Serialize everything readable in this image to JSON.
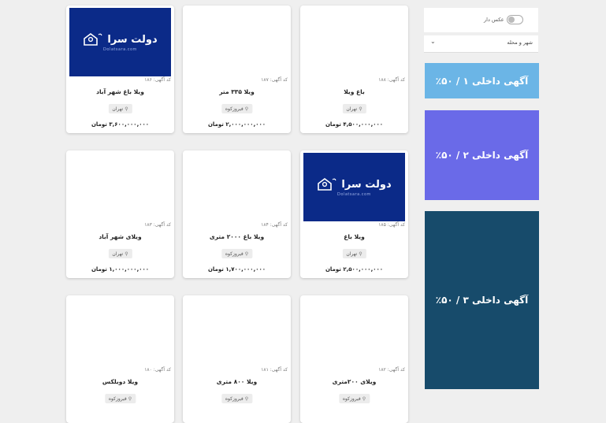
{
  "sidebar": {
    "toggle_label": "عکس دار",
    "select_value": "شهر و محله",
    "banners": [
      {
        "text": "آگهی داخلی ۱ / ۵۰٪",
        "color": "#6bb5e6"
      },
      {
        "text": "آگهی داخلی ۲ / ۵۰٪",
        "color": "#6a6ae8"
      },
      {
        "text": "آگهی داخلی ۳ / ۵۰٪",
        "color": "#174b6b"
      }
    ]
  },
  "brand": {
    "logo_text": "دولت سرا",
    "logo_sub": "Dolatsara.com",
    "color": "#0b2a88"
  },
  "cards": [
    {
      "code": "کد آگهی: ۱۸۸",
      "title": "باغ ویلا",
      "location": "تهران",
      "price": "۴,۵۰۰,۰۰۰,۰۰۰ تومان",
      "has_logo": false
    },
    {
      "code": "کد آگهی: ۱۸۷",
      "title": "ویلا ۳۳۵ متر",
      "location": "فیروزکوه",
      "price": "۲,۰۰۰,۰۰۰,۰۰۰ تومان",
      "has_logo": false
    },
    {
      "code": "کد آگهی: ۱۸۶",
      "title": "ویلا باغ شهر آباد",
      "location": "تهران",
      "price": "۳,۶۰۰,۰۰۰,۰۰۰ تومان",
      "has_logo": true
    },
    {
      "code": "کد آگهی: ۱۸۵",
      "title": "ویلا باغ",
      "location": "تهران",
      "price": "۲,۵۰۰,۰۰۰,۰۰۰ تومان",
      "has_logo": true
    },
    {
      "code": "کد آگهی: ۱۸۴",
      "title": "ویلا باغ ۲۰۰۰ متری",
      "location": "فیروزکوه",
      "price": "۱,۷۰۰,۰۰۰,۰۰۰ تومان",
      "has_logo": false
    },
    {
      "code": "کد آگهی: ۱۸۳",
      "title": "ویلای شهر آباد",
      "location": "تهران",
      "price": "۱,۰۰۰,۰۰۰,۰۰۰ تومان",
      "has_logo": false
    },
    {
      "code": "کد آگهی: ۱۸۲",
      "title": "ویلای ۲۰۰متری",
      "location": "فیروزکوه",
      "price": "",
      "has_logo": false
    },
    {
      "code": "کد آگهی: ۱۸۱",
      "title": "ویلا ۸۰۰ متری",
      "location": "فیروزکوه",
      "price": "",
      "has_logo": false
    },
    {
      "code": "کد آگهی: ۱۸۰",
      "title": "ویلا دوبلکس",
      "location": "فیروزکوه",
      "price": "",
      "has_logo": false
    }
  ]
}
